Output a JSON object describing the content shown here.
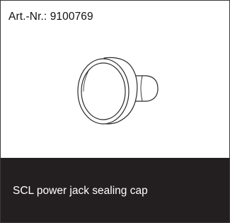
{
  "product": {
    "article_number": "Art.-Nr.: 9100769",
    "name": "SCL power jack sealing cap",
    "image_icon": "sealing-cap-illustration"
  },
  "colors": {
    "caption_background": "#231f20",
    "caption_text": "#ffffff",
    "card_border": "#3a3a3a"
  }
}
